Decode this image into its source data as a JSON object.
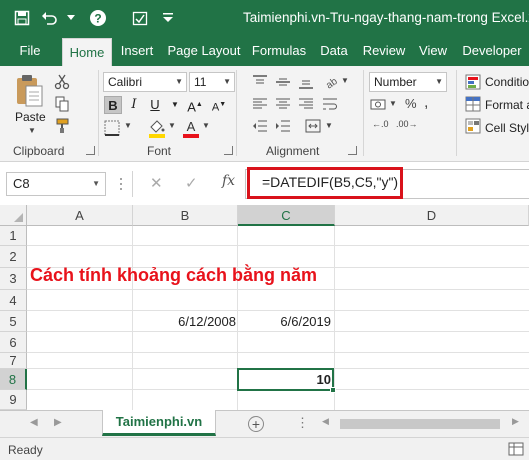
{
  "window": {
    "title": "Taimienphi.vn-Tru-ngay-thang-nam-trong Excel.xlsx"
  },
  "ribbon_tabs": [
    "File",
    "Home",
    "Insert",
    "Page Layout",
    "Formulas",
    "Data",
    "Review",
    "View",
    "Developer"
  ],
  "active_tab": "Home",
  "clipboard": {
    "paste_label": "Paste",
    "group_label": "Clipboard"
  },
  "font": {
    "name": "Calibri",
    "size": "11",
    "group_label": "Font"
  },
  "alignment": {
    "group_label": "Alignment"
  },
  "number": {
    "format": "Number"
  },
  "styles": {
    "conditional": "Conditio",
    "format_as": "Format a",
    "cell_styles": "Cell Styl"
  },
  "formula_bar": {
    "name_box": "C8",
    "formula": "=DATEDIF(B5,C5,\"y\")",
    "fx_label": "fx"
  },
  "sheet": {
    "columns": [
      "A",
      "B",
      "C",
      "D"
    ],
    "rows": [
      "1",
      "2",
      "3",
      "4",
      "5",
      "6",
      "7",
      "8",
      "9"
    ],
    "heading": "Cách tính khoảng cách bằng năm",
    "b5": "6/12/2008",
    "c5": "6/6/2019",
    "c8": "10"
  },
  "sheet_tabs": {
    "active": "Taimienphi.vn"
  },
  "status": {
    "text": "Ready"
  },
  "colors": {
    "excel_green": "#217346",
    "highlight_red": "#d9121b",
    "heading_red": "#e8121b"
  }
}
